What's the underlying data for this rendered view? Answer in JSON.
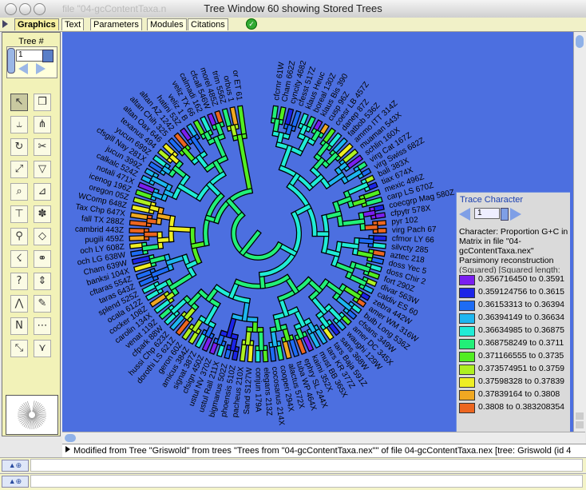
{
  "window": {
    "title": "Tree Window 60 showing Stored Trees",
    "ghost_title": "file \"04-gcContentTaxa.n"
  },
  "tabs": [
    {
      "label": "Graphics",
      "selected": true
    },
    {
      "label": "Text",
      "selected": false
    },
    {
      "label": "Parameters",
      "selected": false
    },
    {
      "label": "Modules",
      "selected": false
    },
    {
      "label": "Citations",
      "selected": false
    }
  ],
  "tree_selector": {
    "label": "Tree #",
    "value": "1"
  },
  "tools": [
    {
      "name": "arrow-tool",
      "glyph": "↖",
      "selected": true
    },
    {
      "name": "info-tool",
      "glyph": "❒"
    },
    {
      "name": "reroot-tool",
      "glyph": "⥿"
    },
    {
      "name": "polytomy-tool",
      "glyph": "⋔"
    },
    {
      "name": "rotate-tool",
      "glyph": "↻"
    },
    {
      "name": "scissors-tool",
      "glyph": "✂"
    },
    {
      "name": "move-branch-tool",
      "glyph": "⤢"
    },
    {
      "name": "collapse-tool",
      "glyph": "▽"
    },
    {
      "name": "magnify-tool",
      "glyph": "⌕"
    },
    {
      "name": "ladderize-tool",
      "glyph": "⊿"
    },
    {
      "name": "name-nodes-tool",
      "glyph": "⊤"
    },
    {
      "name": "color-tool",
      "glyph": "✽"
    },
    {
      "name": "branch-info-tool",
      "glyph": "⚲"
    },
    {
      "name": "highlight-tool",
      "glyph": "◇"
    },
    {
      "name": "trace-tool",
      "glyph": "☇"
    },
    {
      "name": "shadow-tool",
      "glyph": "⚭"
    },
    {
      "name": "help-tool",
      "glyph": "?"
    },
    {
      "name": "stretch-tool",
      "glyph": "⇕"
    },
    {
      "name": "fuse-tool",
      "glyph": "⋀"
    },
    {
      "name": "paint-tool",
      "glyph": "✎"
    },
    {
      "name": "name-tool",
      "glyph": "N"
    },
    {
      "name": "select-tool",
      "glyph": "⋯"
    },
    {
      "name": "prune-tool",
      "glyph": "⤡"
    },
    {
      "name": "expand-tool",
      "glyph": "⋎"
    }
  ],
  "status": {
    "text": "Modified from Tree \"Griswold\" from trees \"Trees from \"04-gcContentTaxa.nex\"\" of file 04-gcContentTaxa.nex  [tree: Griswold (id 4"
  },
  "legend": {
    "title": "Trace Character",
    "char_number": "1",
    "character": "Character: Proportion G+C in Matrix in file \"04-gcContentTaxa.nex\"",
    "reconstruction": "Parsimony reconstruction",
    "reconstruction_extra": "(Squared) [Squared length:",
    "states": [
      {
        "label": "0.356716450 to 0.3591",
        "color": "#7a1ef0"
      },
      {
        "label": "0.359124756 to 0.3615",
        "color": "#1c24e8"
      },
      {
        "label": "0.36153313 to 0.36394",
        "color": "#1e6cf4"
      },
      {
        "label": "0.36394149 to 0.36634",
        "color": "#1eb6f0"
      },
      {
        "label": "0.36634985 to 0.36875",
        "color": "#20ecd6"
      },
      {
        "label": "0.368758249 to 0.3711",
        "color": "#22f078"
      },
      {
        "label": "0.371166555 to 0.3735",
        "color": "#52ee22"
      },
      {
        "label": "0.373574951 to 0.3759",
        "color": "#aef022"
      },
      {
        "label": "0.37598328 to 0.37839",
        "color": "#eeee24"
      },
      {
        "label": "0.37839164 to 0.3808",
        "color": "#f0a822"
      },
      {
        "label": "0.3808 to 0.383208354",
        "color": "#ec6620"
      }
    ]
  },
  "tree": {
    "taxa": [
      {
        "name": "cfcrnr 61W"
      },
      {
        "name": "Cham 662Z"
      },
      {
        "name": "cyncity 4682"
      },
      {
        "name": "cfesst 517Z"
      },
      {
        "name": "klaus Heuc"
      },
      {
        "name": "boreal 130Z"
      },
      {
        "name": "klaus Bis 390"
      },
      {
        "name": "cusp 96Z"
      },
      {
        "name": "coesr LB 457Z"
      },
      {
        "name": "danep 87Z"
      },
      {
        "name": "fatbob 536Z"
      },
      {
        "name": "ammo ITT 314Z"
      },
      {
        "name": "muaman 543X"
      },
      {
        "name": "schlin 160X"
      },
      {
        "name": "virg Cat 167Z"
      },
      {
        "name": "virg Swiss 682Z"
      },
      {
        "name": "bali 383X"
      },
      {
        "name": "tiax 674X"
      },
      {
        "name": "mexic 496Z"
      },
      {
        "name": "carp LS 670Z"
      },
      {
        "name": "coecgrp Mag 580Z"
      },
      {
        "name": "cfpytr 578X"
      },
      {
        "name": "pyr 102"
      },
      {
        "name": "virg Pach 67"
      },
      {
        "name": "cfmor LY 66"
      },
      {
        "name": "silvcty 285"
      },
      {
        "name": "aztec 218"
      },
      {
        "name": "doss Yec 5"
      },
      {
        "name": "doss Chir 2"
      },
      {
        "name": "fort 290Z"
      },
      {
        "name": "divar 563W"
      },
      {
        "name": "caldiv ES 60"
      },
      {
        "name": "zebra 442W"
      },
      {
        "name": "amer WM 316W"
      },
      {
        "name": "bulb Long 536Z"
      },
      {
        "name": "cfsans 349W"
      },
      {
        "name": "amer DC 345X"
      },
      {
        "name": "waughi 129W"
      },
      {
        "name": "sans 368W"
      },
      {
        "name": "tars Baja 591Z"
      },
      {
        "name": "tars KR 377Z"
      },
      {
        "name": "must BB 365X"
      },
      {
        "name": "kaimi 352X"
      },
      {
        "name": "ephry SL 244X"
      },
      {
        "name": "tuba WP 464X"
      },
      {
        "name": "alactus 572X"
      },
      {
        "name": "cooperi 294X"
      },
      {
        "name": "cocosanus 214X"
      },
      {
        "name": "elegans 213Z"
      },
      {
        "name": "conjun 179A"
      },
      {
        "name": "Sand S127W"
      },
      {
        "name": "pacheus 210X"
      },
      {
        "name": "phoensis 510Z"
      },
      {
        "name": "bigmanus 502Z"
      },
      {
        "name": "ustul Rall 211X"
      },
      {
        "name": "ustul NV 370Z"
      },
      {
        "name": "cfsign 450Z"
      },
      {
        "name": "signat 387Z"
      },
      {
        "name": "amicus 384Z"
      },
      {
        "name": "geron 60Z"
      },
      {
        "name": "dorothi LS 621Z"
      },
      {
        "name": "hussi Chp 623Z"
      },
      {
        "name": "cfpark 88W"
      },
      {
        "name": "venat 119Z"
      },
      {
        "name": "carolin 134X"
      },
      {
        "name": "cocker 108Z"
      },
      {
        "name": "ocala 612Z"
      },
      {
        "name": "splend 525Z"
      },
      {
        "name": "taras 643Z"
      },
      {
        "name": "cftaras 554Z"
      },
      {
        "name": "banksi 104X"
      },
      {
        "name": "Cham 639W"
      },
      {
        "name": "och LG 638W"
      },
      {
        "name": "och LY 608Z"
      },
      {
        "name": "pugili 459Z"
      },
      {
        "name": "cambrid 443Z"
      },
      {
        "name": "fall TX 288Z"
      },
      {
        "name": "Tax Chp 647X"
      },
      {
        "name": "WComp 648Z"
      },
      {
        "name": "oregon 05Z"
      },
      {
        "name": "icenog 196Z"
      },
      {
        "name": "notali 471X"
      },
      {
        "name": "calkalc 524Z"
      },
      {
        "name": "jucun 399Z"
      },
      {
        "name": "cfsgill Nay 281X"
      },
      {
        "name": "yucun 699Z"
      },
      {
        "name": "texanus 494"
      },
      {
        "name": "altan Oax 646"
      },
      {
        "name": "altan Chih 325"
      },
      {
        "name": "altan AZ 1242"
      },
      {
        "name": "hatini 53Z"
      },
      {
        "name": "veliz 1 B"
      },
      {
        "name": "veliz TX 66"
      },
      {
        "name": "calmadi 162"
      },
      {
        "name": "cfcall 546W"
      },
      {
        "name": "morel 485Z"
      },
      {
        "name": "trim 556Z"
      },
      {
        "name": "orbus 1"
      },
      {
        "name": "or ET 61"
      }
    ]
  }
}
